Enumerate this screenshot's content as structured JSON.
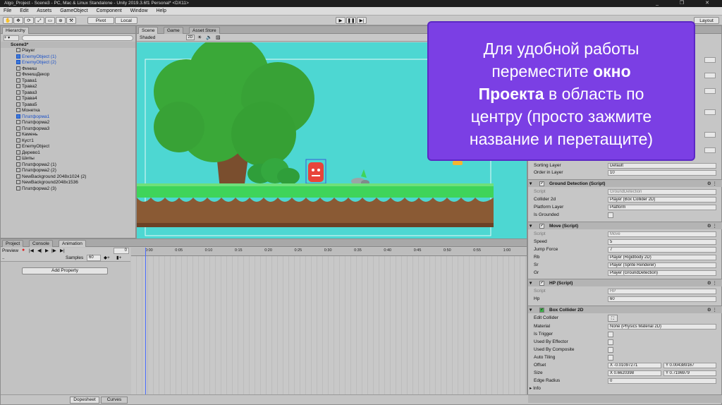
{
  "window": {
    "title": "Algo_Project - Scene3 - PC, Mac & Linux Standalone - Unity 2019.3.6f1 Personal* <DX11>",
    "controls": "_ ❐ ✕"
  },
  "menu": [
    "File",
    "Edit",
    "Assets",
    "GameObject",
    "Component",
    "Window",
    "Help"
  ],
  "toolbar": {
    "pivot": "Pivot",
    "local": "Local",
    "layout": "Layout"
  },
  "hierarchy": {
    "tab": "Hierarchy",
    "scene": "Scene3*",
    "items": [
      {
        "label": "Player",
        "blue": false
      },
      {
        "label": "EnemyObject (1)",
        "blue": true
      },
      {
        "label": "EnemyObject (2)",
        "blue": true
      },
      {
        "label": "Финиш",
        "blue": false
      },
      {
        "label": "ФинишДекор",
        "blue": false
      },
      {
        "label": "Трава1",
        "blue": false
      },
      {
        "label": "Трава2",
        "blue": false
      },
      {
        "label": "Трава3",
        "blue": false
      },
      {
        "label": "Трава4",
        "blue": false
      },
      {
        "label": "Трава5",
        "blue": false
      },
      {
        "label": "Монетка",
        "blue": false
      },
      {
        "label": "Платформа1",
        "blue": true
      },
      {
        "label": "Платформа2",
        "blue": false
      },
      {
        "label": "Платформа3",
        "blue": false
      },
      {
        "label": "Камень",
        "blue": false
      },
      {
        "label": "Куст1",
        "blue": false
      },
      {
        "label": "EnemyObject",
        "blue": false
      },
      {
        "label": "Дерево1",
        "blue": false
      },
      {
        "label": "Шипы",
        "blue": false
      },
      {
        "label": "Платформа2 (1)",
        "blue": false
      },
      {
        "label": "Платформа2 (2)",
        "blue": false
      },
      {
        "label": "NewBackground 2048x1024 (2)",
        "blue": false
      },
      {
        "label": "NewBackground2048x1536",
        "blue": false
      },
      {
        "label": "Платформа2 (3)",
        "blue": false
      }
    ]
  },
  "scene": {
    "tabs": [
      "Scene",
      "Game",
      "Asset Store"
    ],
    "shading": "Shaded",
    "mode2d": "2D"
  },
  "bottom_panel": {
    "tabs": [
      "Project",
      "Console",
      "Animation"
    ],
    "preview": "Preview",
    "samples_label": "Samples",
    "samples_value": "60",
    "frame_value": "0",
    "add_property": "Add Property",
    "dopesheet": "Dopesheet",
    "curves": "Curves",
    "timeline": [
      "0:00",
      "0:05",
      "0:10",
      "0:15",
      "0:20",
      "0:25",
      "0:30",
      "0:35",
      "0:40",
      "0:45",
      "0:50",
      "0:55",
      "1:00"
    ]
  },
  "inspector": {
    "sorting_layer": {
      "label": "Sorting Layer",
      "value": "Default"
    },
    "order_in_layer": {
      "label": "Order in Layer",
      "value": "10"
    },
    "ground_detection": {
      "title": "Ground Detection (Script)",
      "script": {
        "label": "Script",
        "value": "GroundDetection"
      },
      "collider": {
        "label": "Collider 2d",
        "value": "Player (Box Collider 2D)"
      },
      "platform_layer": {
        "label": "Platform Layer",
        "value": "Platform"
      },
      "is_grounded": {
        "label": "Is Grounded"
      }
    },
    "move": {
      "title": "Move (Script)",
      "script": {
        "label": "Script",
        "value": "Move"
      },
      "speed": {
        "label": "Speed",
        "value": "5"
      },
      "jump_force": {
        "label": "Jump Force",
        "value": "7"
      },
      "rb": {
        "label": "Rb",
        "value": "Player (Rigidbody 2D)"
      },
      "sr": {
        "label": "Sr",
        "value": "Player (Sprite Renderer)"
      },
      "gr": {
        "label": "Gr",
        "value": "Player (GroundDetection)"
      }
    },
    "hp": {
      "title": "HP (Script)",
      "script": {
        "label": "Script",
        "value": "HP"
      },
      "hp": {
        "label": "Hp",
        "value": "60"
      }
    },
    "box_collider": {
      "title": "Box Collider 2D",
      "edit_collider": "Edit Collider",
      "material": {
        "label": "Material",
        "value": "None (Physics Material 2D)"
      },
      "is_trigger": "Is Trigger",
      "used_by_effector": "Used By Effector",
      "used_by_composite": "Used By Composite",
      "auto_tiling": "Auto Tiling",
      "offset": {
        "label": "Offset",
        "x": "X -0.01097271",
        "y": "Y 0.004389167"
      },
      "size": {
        "label": "Size",
        "x": "X 0.6620398",
        "y": "Y 0.7196979"
      },
      "edge_radius": {
        "label": "Edge Radius",
        "value": "0"
      },
      "info": "Info"
    }
  },
  "overlay": {
    "line1": "Для удобной работы",
    "line2_pre": "переместите ",
    "line2_bold": "окно",
    "line3_bold": "Проекта",
    "line3_post": " в область по",
    "line4": "центру (просто зажмите",
    "line5": "название и перетащите)"
  },
  "colors": {
    "overlay_bg": "#7b3fe4",
    "scene_bg": "#4dd7d2",
    "grass": "#3fd45a",
    "dirt": "#8a5a34",
    "tree": "#3aa838",
    "enemy": "#e8443a"
  }
}
